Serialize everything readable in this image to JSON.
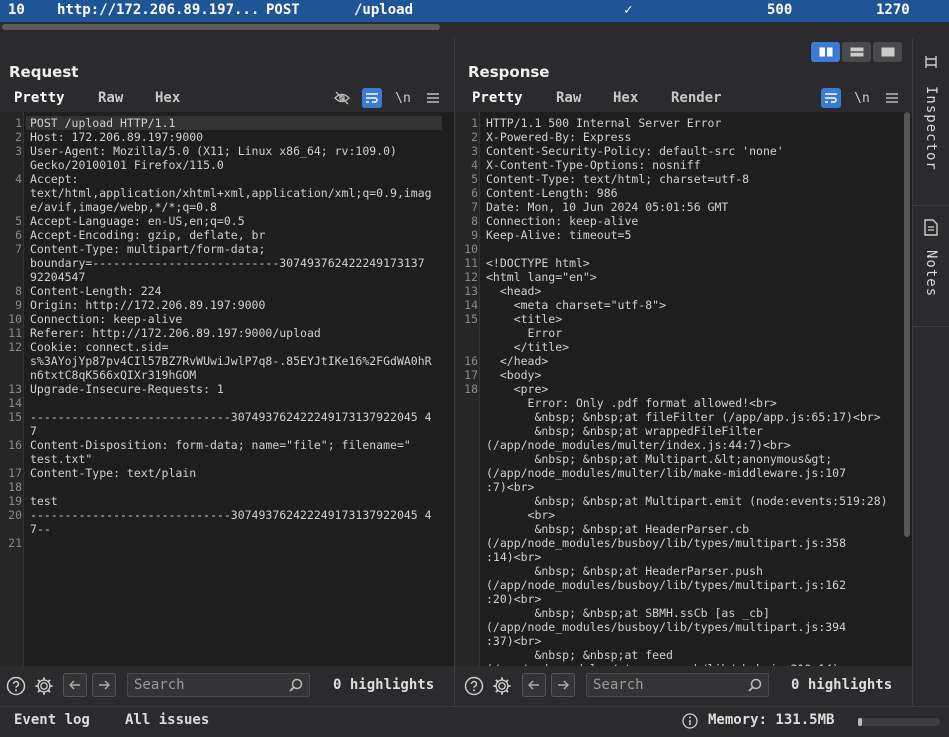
{
  "top_row": {
    "num": "10",
    "host": "http://172.206.89.197...",
    "method": "POST",
    "path": "/upload",
    "check": "✓",
    "status": "500",
    "length": "1270"
  },
  "request": {
    "title": "Request",
    "tabs": [
      "Pretty",
      "Raw",
      "Hex"
    ],
    "lines": [
      {
        "n": "1",
        "t": "POST /upload HTTP/1.1"
      },
      {
        "n": "2",
        "t": "Host: 172.206.89.197:9000"
      },
      {
        "n": "3",
        "t": "User-Agent: Mozilla/5.0 (X11; Linux x86_64; rv:109.0)"
      },
      {
        "n": "",
        "t": "Gecko/20100101 Firefox/115.0"
      },
      {
        "n": "4",
        "t": "Accept:"
      },
      {
        "n": "",
        "t": "text/html,application/xhtml+xml,application/xml;q=0.9,imag"
      },
      {
        "n": "",
        "t": "e/avif,image/webp,*/*;q=0.8"
      },
      {
        "n": "5",
        "t": "Accept-Language: en-US,en;q=0.5"
      },
      {
        "n": "6",
        "t": "Accept-Encoding: gzip, deflate, br"
      },
      {
        "n": "7",
        "t": "Content-Type: multipart/form-data;"
      },
      {
        "n": "",
        "t": "boundary=---------------------------307493762422249173137"
      },
      {
        "n": "",
        "t": "92204547"
      },
      {
        "n": "8",
        "t": "Content-Length: 224"
      },
      {
        "n": "9",
        "t": "Origin: http://172.206.89.197:9000"
      },
      {
        "n": "10",
        "t": "Connection: keep-alive"
      },
      {
        "n": "11",
        "t": "Referer: http://172.206.89.197:9000/upload"
      },
      {
        "n": "12",
        "t": "Cookie: connect.sid="
      },
      {
        "n": "",
        "t": "s%3AYojYp87pv4CIl57BZ7RvWUwiJwlP7q8-.85EYJtIKe16%2FGdWA0hR"
      },
      {
        "n": "",
        "t": "n6txtC8qK566xQIXr319hGOM"
      },
      {
        "n": "13",
        "t": "Upgrade-Insecure-Requests: 1"
      },
      {
        "n": "14",
        "t": ""
      },
      {
        "n": "15",
        "t": "-----------------------------307493762422249173137922045 4"
      },
      {
        "n": "",
        "t": "7"
      },
      {
        "n": "16",
        "t": "Content-Disposition: form-data; name=\"file\"; filename=\""
      },
      {
        "n": "",
        "t": "test.txt\""
      },
      {
        "n": "17",
        "t": "Content-Type: text/plain"
      },
      {
        "n": "18",
        "t": ""
      },
      {
        "n": "19",
        "t": "test"
      },
      {
        "n": "20",
        "t": "-----------------------------307493762422249173137922045 4"
      },
      {
        "n": "",
        "t": "7--"
      },
      {
        "n": "21",
        "t": ""
      }
    ],
    "search_placeholder": "Search",
    "highlights": "0 highlights"
  },
  "response": {
    "title": "Response",
    "tabs": [
      "Pretty",
      "Raw",
      "Hex",
      "Render"
    ],
    "lines": [
      {
        "n": "1",
        "t": "HTTP/1.1 500 Internal Server Error"
      },
      {
        "n": "2",
        "t": "X-Powered-By: Express"
      },
      {
        "n": "3",
        "t": "Content-Security-Policy: default-src 'none'"
      },
      {
        "n": "4",
        "t": "X-Content-Type-Options: nosniff"
      },
      {
        "n": "5",
        "t": "Content-Type: text/html; charset=utf-8"
      },
      {
        "n": "6",
        "t": "Content-Length: 986"
      },
      {
        "n": "7",
        "t": "Date: Mon, 10 Jun 2024 05:01:56 GMT"
      },
      {
        "n": "8",
        "t": "Connection: keep-alive"
      },
      {
        "n": "9",
        "t": "Keep-Alive: timeout=5"
      },
      {
        "n": "10",
        "t": ""
      },
      {
        "n": "11",
        "t": "<!DOCTYPE html>"
      },
      {
        "n": "12",
        "t": "<html lang=\"en\">"
      },
      {
        "n": "13",
        "t": "  <head>"
      },
      {
        "n": "14",
        "t": "    <meta charset=\"utf-8\">"
      },
      {
        "n": "15",
        "t": "    <title>"
      },
      {
        "n": "",
        "t": "      Error"
      },
      {
        "n": "",
        "t": "    </title>"
      },
      {
        "n": "16",
        "t": "  </head>"
      },
      {
        "n": "17",
        "t": "  <body>"
      },
      {
        "n": "18",
        "t": "    <pre>"
      },
      {
        "n": "",
        "t": "      Error: Only .pdf format allowed!<br>"
      },
      {
        "n": "",
        "t": "       &nbsp; &nbsp;at fileFilter (/app/app.js:65:17)<br>"
      },
      {
        "n": "",
        "t": "       &nbsp; &nbsp;at wrappedFileFilter"
      },
      {
        "n": "",
        "t": "(/app/node_modules/multer/index.js:44:7)<br>"
      },
      {
        "n": "",
        "t": "       &nbsp; &nbsp;at Multipart.&lt;anonymous&gt;"
      },
      {
        "n": "",
        "t": "(/app/node_modules/multer/lib/make-middleware.js:107"
      },
      {
        "n": "",
        "t": ":7)<br>"
      },
      {
        "n": "",
        "t": "       &nbsp; &nbsp;at Multipart.emit (node:events:519:28)"
      },
      {
        "n": "",
        "t": "      <br>"
      },
      {
        "n": "",
        "t": "       &nbsp; &nbsp;at HeaderParser.cb"
      },
      {
        "n": "",
        "t": "(/app/node_modules/busboy/lib/types/multipart.js:358"
      },
      {
        "n": "",
        "t": ":14)<br>"
      },
      {
        "n": "",
        "t": "       &nbsp; &nbsp;at HeaderParser.push"
      },
      {
        "n": "",
        "t": "(/app/node_modules/busboy/lib/types/multipart.js:162"
      },
      {
        "n": "",
        "t": ":20)<br>"
      },
      {
        "n": "",
        "t": "       &nbsp; &nbsp;at SBMH.ssCb [as _cb]"
      },
      {
        "n": "",
        "t": "(/app/node_modules/busboy/lib/types/multipart.js:394"
      },
      {
        "n": "",
        "t": ":37)<br>"
      },
      {
        "n": "",
        "t": "       &nbsp; &nbsp;at feed"
      },
      {
        "n": "",
        "t": "(/app/node_modules/streamsearch/lib/sbmh.js:219:14)<"
      }
    ],
    "search_placeholder": "Search",
    "highlights": "0 highlights"
  },
  "sidebar": {
    "inspector": "Inspector",
    "notes": "Notes"
  },
  "footer": {
    "event_log": "Event log",
    "all_issues": "All issues",
    "memory": "Memory: 131.5MB"
  },
  "colors": {
    "accent": "#3a7bd5",
    "tab_underline": "#e8793a",
    "selected_row": "#1f5597"
  }
}
